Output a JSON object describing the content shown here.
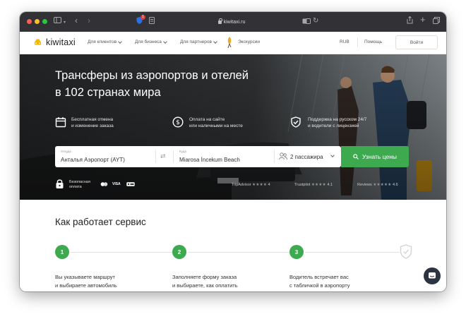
{
  "browser": {
    "url": "kiwitaxi.ru",
    "extension_badge": "1"
  },
  "nav": {
    "logo": "kiwitaxi",
    "links": [
      "Для клиентов",
      "Для бизнеса",
      "Для партнеров",
      "Экскурсии"
    ],
    "currency": "RUB",
    "help": "Помощь",
    "login": "Войти"
  },
  "hero": {
    "title_line1": "Трансферы из аэропортов и отелей",
    "title_line2": "в 102 странах мира",
    "features": [
      {
        "icon": "calendar-icon",
        "line1": "Бесплатная отмена",
        "line2": "и изменение заказа"
      },
      {
        "icon": "dollar-icon",
        "line1": "Оплата на сайте",
        "line2": "или наличными на месте"
      },
      {
        "icon": "shield-check-icon",
        "line1": "Поддержка на русском 24/7",
        "line2": "и водители с лицензией"
      }
    ],
    "search": {
      "from_label": "Откуда",
      "from_value": "Анталья Аэропорт (AYT)",
      "to_label": "Куда",
      "to_value": "Miarosa İncekum Beach",
      "passengers": "2 пассажира",
      "button": "Узнать цены"
    },
    "payment": {
      "line1": "Безопасная",
      "line2": "оплата",
      "cards": [
        "VISA"
      ]
    },
    "ratings": [
      {
        "name": "TripAdvisor",
        "score": "4"
      },
      {
        "name": "Trustpilot",
        "score": "4.1"
      },
      {
        "name": "Reviews",
        "score": "4.6"
      }
    ]
  },
  "how": {
    "title": "Как работает сервис",
    "steps": [
      {
        "num": "1",
        "line1": "Вы указываете маршрут",
        "line2": "и выбираете автомобиль"
      },
      {
        "num": "2",
        "line1": "Заполняете форму заказа",
        "line2": "и выбираете, как оплатить"
      },
      {
        "num": "3",
        "line1": "Водитель встречает вас",
        "line2": "с табличкой в аэропорту"
      }
    ]
  },
  "colors": {
    "accent": "#3eaa4f",
    "toolbar": "#323236",
    "hero_dark": "#2a2b2c"
  }
}
